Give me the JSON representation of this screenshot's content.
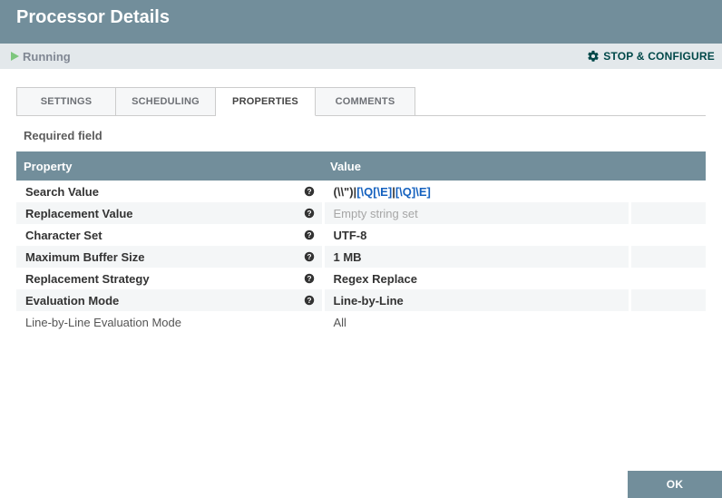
{
  "header": {
    "title": "Processor Details"
  },
  "status": {
    "running_label": "Running",
    "action_label": "STOP & CONFIGURE"
  },
  "tabs": [
    {
      "id": "settings",
      "label": "SETTINGS"
    },
    {
      "id": "scheduling",
      "label": "SCHEDULING"
    },
    {
      "id": "properties",
      "label": "PROPERTIES"
    },
    {
      "id": "comments",
      "label": "COMMENTS"
    }
  ],
  "active_tab": "properties",
  "properties_pane": {
    "section_label": "Required field",
    "columns": {
      "property": "Property",
      "value": "Value"
    },
    "rows": [
      {
        "required": true,
        "name": "Search Value",
        "value_segments": [
          {
            "t": "(\\\\\")|",
            "c": "plain"
          },
          {
            "t": "[\\Q[\\E]",
            "c": "blue"
          },
          {
            "t": "|",
            "c": "plain"
          },
          {
            "t": "[\\Q]\\E]",
            "c": "blue"
          }
        ]
      },
      {
        "required": true,
        "name": "Replacement Value",
        "value": "Empty string set",
        "empty": true
      },
      {
        "required": true,
        "name": "Character Set",
        "value": "UTF-8"
      },
      {
        "required": true,
        "name": "Maximum Buffer Size",
        "value": "1 MB"
      },
      {
        "required": true,
        "name": "Replacement Strategy",
        "value": "Regex Replace"
      },
      {
        "required": true,
        "name": "Evaluation Mode",
        "value": "Line-by-Line"
      },
      {
        "required": false,
        "name": "Line-by-Line Evaluation Mode",
        "value": "All"
      }
    ]
  },
  "footer": {
    "ok_label": "OK"
  },
  "icons": {
    "play": "play-icon",
    "gear": "gear-icon",
    "help": "help-icon"
  },
  "colors": {
    "brand": "#728E9B",
    "accent_green": "#7DC67D",
    "action_teal": "#004849",
    "link_blue": "#1662BF",
    "muted_bg": "#E3E8EB"
  }
}
